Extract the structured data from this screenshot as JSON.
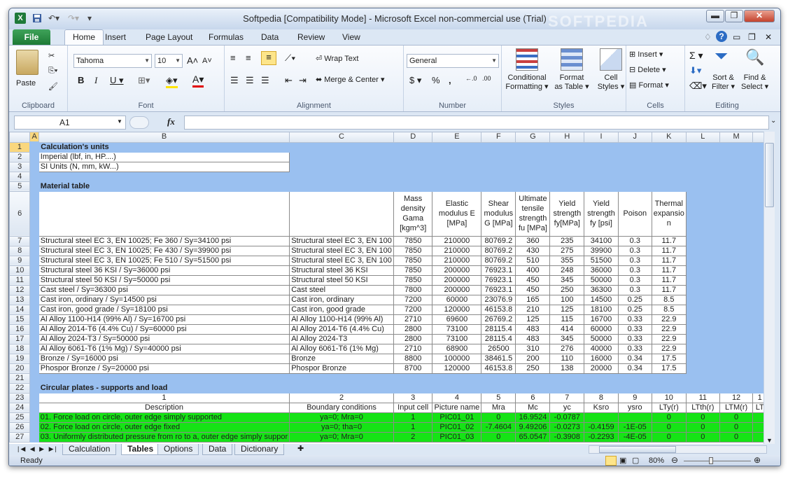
{
  "titlebar": {
    "title": "Softpedia  [Compatibility Mode]  -  Microsoft Excel non-commercial use (Trial)",
    "watermark": "SOFTPEDIA"
  },
  "tabs": [
    "File",
    "Home",
    "Insert",
    "Page Layout",
    "Formulas",
    "Data",
    "Review",
    "View"
  ],
  "ribbon": {
    "clipboard": {
      "label": "Clipboard",
      "paste": "Paste"
    },
    "font": {
      "label": "Font",
      "name": "Tahoma",
      "size": "10"
    },
    "alignment": {
      "label": "Alignment",
      "wrap": "Wrap Text",
      "merge": "Merge & Center"
    },
    "number": {
      "label": "Number",
      "format": "General"
    },
    "styles": {
      "label": "Styles",
      "cond": [
        "Conditional",
        "Formatting"
      ],
      "table": [
        "Format",
        "as Table"
      ],
      "cell": [
        "Cell",
        "Styles"
      ]
    },
    "cells": {
      "label": "Cells",
      "insert": "Insert",
      "delete": "Delete",
      "format": "Format"
    },
    "editing": {
      "label": "Editing",
      "sort": [
        "Sort &",
        "Filter"
      ],
      "find": [
        "Find &",
        "Select"
      ]
    }
  },
  "namebox": "A1",
  "fx": "fx",
  "columns": [
    "A",
    "B",
    "C",
    "D",
    "E",
    "F",
    "G",
    "H",
    "I",
    "J",
    "K",
    "L",
    "M",
    ""
  ],
  "rows": [
    {
      "n": "1",
      "cells": [
        {
          "t": ""
        },
        {
          "t": "Calculation's units",
          "cls": "b"
        }
      ]
    },
    {
      "n": "2",
      "cells": [
        {
          "t": ""
        },
        {
          "t": "Imperial (lbf, in, HP....)"
        }
      ]
    },
    {
      "n": "3",
      "cells": [
        {
          "t": ""
        },
        {
          "t": "SI Units (N, mm, kW...)"
        }
      ]
    },
    {
      "n": "4",
      "cells": []
    },
    {
      "n": "5",
      "cells": [
        {
          "t": ""
        },
        {
          "t": "Material table",
          "cls": "b"
        }
      ]
    },
    {
      "n": "6",
      "cells": []
    },
    {
      "n": "7",
      "cells": [
        {
          "t": ""
        },
        {
          "t": "Structural steel EC 3, EN 10025; Fe 360 / Sy=34100 psi"
        },
        {
          "t": "Structural steel EC 3, EN 100"
        },
        {
          "t": "7850"
        },
        {
          "t": "210000"
        },
        {
          "t": "80769.2"
        },
        {
          "t": "360"
        },
        {
          "t": "235"
        },
        {
          "t": "34100"
        },
        {
          "t": "0.3"
        },
        {
          "t": "11.7"
        }
      ]
    },
    {
      "n": "8",
      "cells": [
        {
          "t": ""
        },
        {
          "t": "Structural steel EC 3, EN 10025; Fe 430 / Sy=39900 psi"
        },
        {
          "t": "Structural steel EC 3, EN 100"
        },
        {
          "t": "7850"
        },
        {
          "t": "210000"
        },
        {
          "t": "80769.2"
        },
        {
          "t": "430"
        },
        {
          "t": "275"
        },
        {
          "t": "39900"
        },
        {
          "t": "0.3"
        },
        {
          "t": "11.7"
        }
      ]
    },
    {
      "n": "9",
      "cells": [
        {
          "t": ""
        },
        {
          "t": "Structural steel EC 3, EN 10025; Fe 510 / Sy=51500 psi"
        },
        {
          "t": "Structural steel EC 3, EN 100"
        },
        {
          "t": "7850"
        },
        {
          "t": "210000"
        },
        {
          "t": "80769.2"
        },
        {
          "t": "510"
        },
        {
          "t": "355"
        },
        {
          "t": "51500"
        },
        {
          "t": "0.3"
        },
        {
          "t": "11.7"
        }
      ]
    },
    {
      "n": "10",
      "cells": [
        {
          "t": ""
        },
        {
          "t": "Structural steel 36 KSI / Sy=36000 psi"
        },
        {
          "t": "Structural steel 36 KSI"
        },
        {
          "t": "7850"
        },
        {
          "t": "200000"
        },
        {
          "t": "76923.1"
        },
        {
          "t": "400"
        },
        {
          "t": "248"
        },
        {
          "t": "36000"
        },
        {
          "t": "0.3"
        },
        {
          "t": "11.7"
        }
      ]
    },
    {
      "n": "11",
      "cells": [
        {
          "t": ""
        },
        {
          "t": "Structural steel 50 KSI / Sy=50000 psi"
        },
        {
          "t": "Structural steel 50 KSI"
        },
        {
          "t": "7850"
        },
        {
          "t": "200000"
        },
        {
          "t": "76923.1"
        },
        {
          "t": "450"
        },
        {
          "t": "345"
        },
        {
          "t": "50000"
        },
        {
          "t": "0.3"
        },
        {
          "t": "11.7"
        }
      ]
    },
    {
      "n": "12",
      "cells": [
        {
          "t": ""
        },
        {
          "t": "Cast steel / Sy=36300 psi"
        },
        {
          "t": "Cast steel"
        },
        {
          "t": "7800"
        },
        {
          "t": "200000"
        },
        {
          "t": "76923.1"
        },
        {
          "t": "450"
        },
        {
          "t": "250"
        },
        {
          "t": "36300"
        },
        {
          "t": "0.3"
        },
        {
          "t": "11.7"
        }
      ]
    },
    {
      "n": "13",
      "cells": [
        {
          "t": ""
        },
        {
          "t": "Cast iron, ordinary / Sy=14500 psi"
        },
        {
          "t": "Cast iron, ordinary"
        },
        {
          "t": "7200"
        },
        {
          "t": "60000"
        },
        {
          "t": "23076.9"
        },
        {
          "t": "165"
        },
        {
          "t": "100"
        },
        {
          "t": "14500"
        },
        {
          "t": "0.25"
        },
        {
          "t": "8.5"
        }
      ]
    },
    {
      "n": "14",
      "cells": [
        {
          "t": ""
        },
        {
          "t": "Cast iron, good grade / Sy=18100 psi"
        },
        {
          "t": "Cast iron, good grade"
        },
        {
          "t": "7200"
        },
        {
          "t": "120000"
        },
        {
          "t": "46153.8"
        },
        {
          "t": "210"
        },
        {
          "t": "125"
        },
        {
          "t": "18100"
        },
        {
          "t": "0.25"
        },
        {
          "t": "8.5"
        }
      ]
    },
    {
      "n": "15",
      "cells": [
        {
          "t": ""
        },
        {
          "t": "Al Alloy 1100-H14 (99% Al) / Sy=16700 psi"
        },
        {
          "t": "Al Alloy 1100-H14 (99% Al)"
        },
        {
          "t": "2710"
        },
        {
          "t": "69600"
        },
        {
          "t": "26769.2"
        },
        {
          "t": "125"
        },
        {
          "t": "115"
        },
        {
          "t": "16700"
        },
        {
          "t": "0.33"
        },
        {
          "t": "22.9"
        }
      ]
    },
    {
      "n": "16",
      "cells": [
        {
          "t": ""
        },
        {
          "t": "Al Alloy 2014-T6 (4.4% Cu) / Sy=60000 psi"
        },
        {
          "t": "Al Alloy 2014-T6 (4.4% Cu)"
        },
        {
          "t": "2800"
        },
        {
          "t": "73100"
        },
        {
          "t": "28115.4"
        },
        {
          "t": "483"
        },
        {
          "t": "414"
        },
        {
          "t": "60000"
        },
        {
          "t": "0.33"
        },
        {
          "t": "22.9"
        }
      ]
    },
    {
      "n": "17",
      "cells": [
        {
          "t": ""
        },
        {
          "t": "Al Alloy 2024-T3 / Sy=50000 psi"
        },
        {
          "t": "Al Alloy 2024-T3"
        },
        {
          "t": "2800"
        },
        {
          "t": "73100"
        },
        {
          "t": "28115.4"
        },
        {
          "t": "483"
        },
        {
          "t": "345"
        },
        {
          "t": "50000"
        },
        {
          "t": "0.33"
        },
        {
          "t": "22.9"
        }
      ]
    },
    {
      "n": "18",
      "cells": [
        {
          "t": ""
        },
        {
          "t": "Al Alloy 6061-T6 (1% Mg) / Sy=40000 psi"
        },
        {
          "t": "Al Alloy 6061-T6 (1% Mg)"
        },
        {
          "t": "2710"
        },
        {
          "t": "68900"
        },
        {
          "t": "26500"
        },
        {
          "t": "310"
        },
        {
          "t": "276"
        },
        {
          "t": "40000"
        },
        {
          "t": "0.33"
        },
        {
          "t": "22.9"
        }
      ]
    },
    {
      "n": "19",
      "cells": [
        {
          "t": ""
        },
        {
          "t": "Bronze / Sy=16000 psi"
        },
        {
          "t": "Bronze"
        },
        {
          "t": "8800"
        },
        {
          "t": "100000"
        },
        {
          "t": "38461.5"
        },
        {
          "t": "200"
        },
        {
          "t": "110"
        },
        {
          "t": "16000"
        },
        {
          "t": "0.34"
        },
        {
          "t": "17.5"
        }
      ]
    },
    {
      "n": "20",
      "cells": [
        {
          "t": ""
        },
        {
          "t": "Phospor Bronze / Sy=20000 psi"
        },
        {
          "t": "Phospor Bronze"
        },
        {
          "t": "8700"
        },
        {
          "t": "120000"
        },
        {
          "t": "46153.8"
        },
        {
          "t": "250"
        },
        {
          "t": "138"
        },
        {
          "t": "20000"
        },
        {
          "t": "0.34"
        },
        {
          "t": "17.5"
        }
      ]
    },
    {
      "n": "21",
      "cells": []
    },
    {
      "n": "22",
      "cells": [
        {
          "t": ""
        },
        {
          "t": "Circular plates - supports and load",
          "cls": "b"
        }
      ]
    },
    {
      "n": "23",
      "cells": [
        {
          "t": ""
        },
        {
          "t": "1"
        },
        {
          "t": "2"
        },
        {
          "t": "3"
        },
        {
          "t": "4"
        },
        {
          "t": "5"
        },
        {
          "t": "6"
        },
        {
          "t": "7"
        },
        {
          "t": "8"
        },
        {
          "t": "9"
        },
        {
          "t": "10"
        },
        {
          "t": "11"
        },
        {
          "t": "12"
        },
        {
          "t": "1"
        }
      ]
    },
    {
      "n": "24",
      "cells": [
        {
          "t": ""
        },
        {
          "t": "Description"
        },
        {
          "t": "Boundary conditions"
        },
        {
          "t": "Input cell"
        },
        {
          "t": "Picture name"
        },
        {
          "t": "Mra"
        },
        {
          "t": "Mc"
        },
        {
          "t": "yc"
        },
        {
          "t": "Ksro"
        },
        {
          "t": "ysro"
        },
        {
          "t": "LTy(r)"
        },
        {
          "t": "LTth(r)"
        },
        {
          "t": "LTM(r)"
        },
        {
          "t": "LT"
        }
      ]
    },
    {
      "n": "25",
      "cells": [
        {
          "t": ""
        },
        {
          "t": "01. Force load on circle, outer edge simply supported"
        },
        {
          "t": "ya=0; Mra=0"
        },
        {
          "t": "1"
        },
        {
          "t": "PIC01_01"
        },
        {
          "t": "0"
        },
        {
          "t": "16.9524"
        },
        {
          "t": "-0.0787"
        },
        {
          "t": ""
        },
        {
          "t": ""
        },
        {
          "t": "0"
        },
        {
          "t": "0"
        },
        {
          "t": "0"
        },
        {
          "t": ""
        }
      ]
    },
    {
      "n": "26",
      "cells": [
        {
          "t": ""
        },
        {
          "t": "02. Force load on circle, outer edge fixed"
        },
        {
          "t": "ya=0; tha=0"
        },
        {
          "t": "1"
        },
        {
          "t": "PIC01_02"
        },
        {
          "t": "-7.4604"
        },
        {
          "t": "9.49206"
        },
        {
          "t": "-0.0273"
        },
        {
          "t": "-0.4159"
        },
        {
          "t": "-1E-05"
        },
        {
          "t": "0"
        },
        {
          "t": "0"
        },
        {
          "t": "0"
        },
        {
          "t": ""
        }
      ]
    },
    {
      "n": "27",
      "cells": [
        {
          "t": ""
        },
        {
          "t": "03. Uniformly distributed pressure from ro to a, outer edge simply suppor"
        },
        {
          "t": "ya=0; Mra=0"
        },
        {
          "t": "2"
        },
        {
          "t": "PIC01_03"
        },
        {
          "t": "0"
        },
        {
          "t": "65.0547"
        },
        {
          "t": "-0.3908"
        },
        {
          "t": "-0.2293"
        },
        {
          "t": "-4E-05"
        },
        {
          "t": "0"
        },
        {
          "t": "0"
        },
        {
          "t": "0"
        },
        {
          "t": ""
        }
      ]
    }
  ],
  "headers6": {
    "D": [
      "Mass",
      "density",
      "Gama",
      "[kgm^3]"
    ],
    "E": [
      "Elastic",
      "modulus E",
      "[MPa]"
    ],
    "F": [
      "Shear",
      "modulus",
      "G [MPa]"
    ],
    "G": [
      "Ultimate",
      "tensile",
      "strength",
      "fu [MPa]"
    ],
    "H": [
      "Yield",
      "strength",
      "fy[MPa]"
    ],
    "I": [
      "Yield",
      "strength",
      "fy [psi]"
    ],
    "J": [
      "Poison"
    ],
    "K": [
      "Thermal",
      "expansio",
      "n"
    ]
  },
  "sheets": [
    "Calculation",
    "Tables",
    "Options",
    "Data",
    "Dictionary"
  ],
  "active_sheet": "Tables",
  "status": {
    "ready": "Ready",
    "zoom": "80%"
  }
}
